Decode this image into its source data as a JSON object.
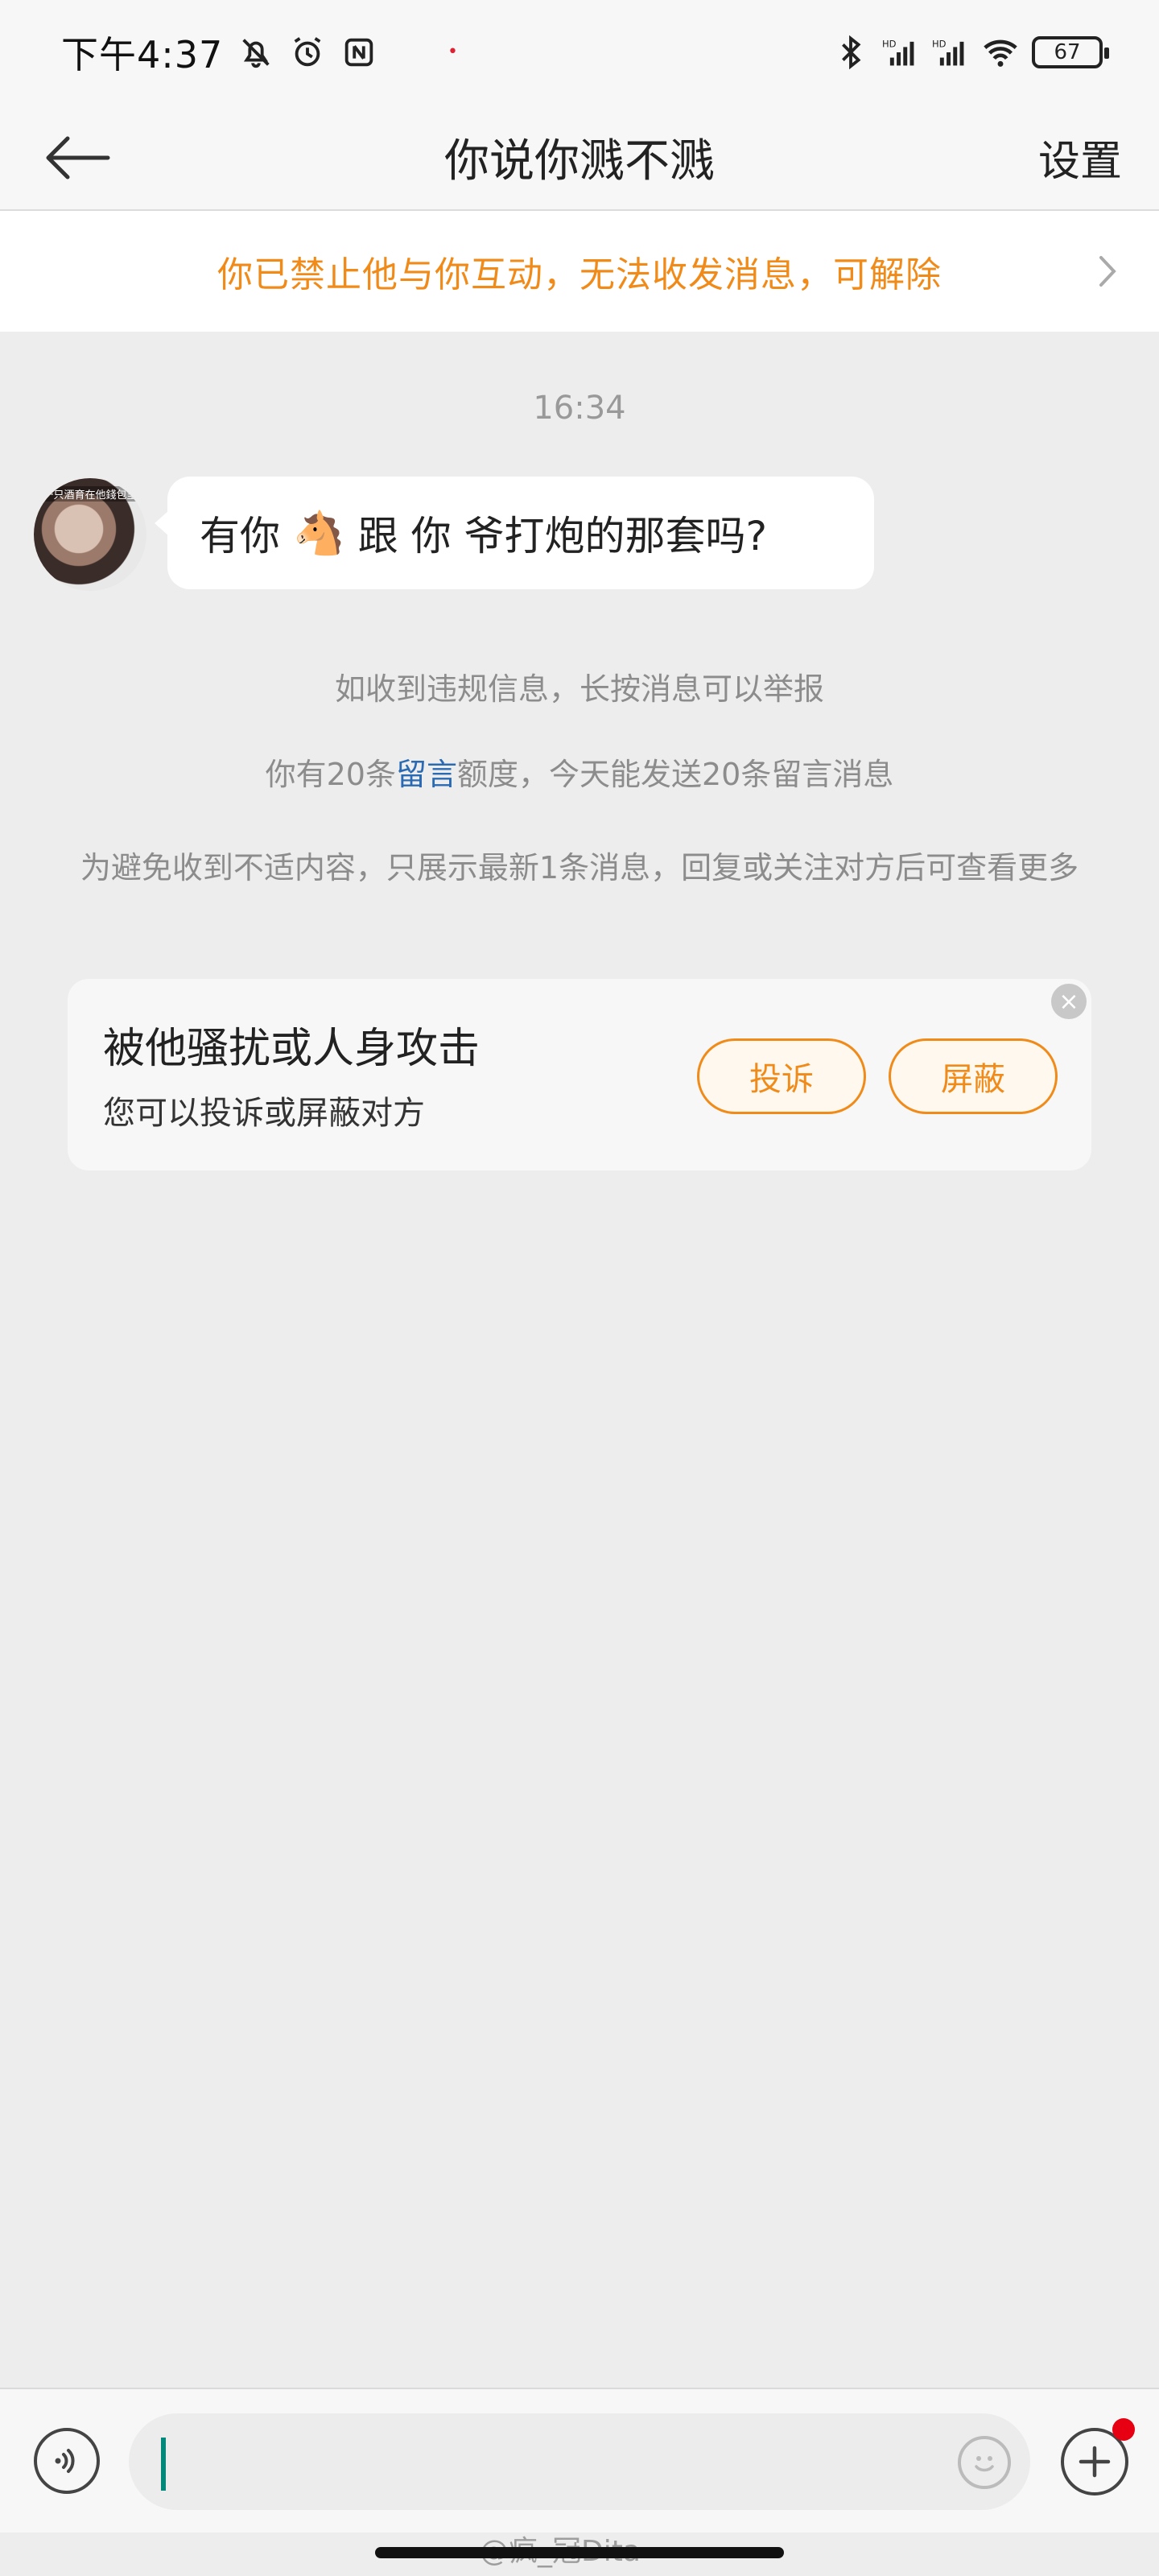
{
  "status_bar": {
    "time": "下午4:37",
    "battery": "67"
  },
  "nav": {
    "title": "你说你溅不溅",
    "settings_label": "设置"
  },
  "banner": {
    "text": "你已禁止他与你互动，无法收发消息，可解除"
  },
  "chat": {
    "timestamp": "16:34",
    "avatar_caption": "一只酒育在他錢包里",
    "message_pre": "有你",
    "message_emoji": "🐴",
    "message_post": "跟 你 爷打炮的那套吗?"
  },
  "system_notes": {
    "report": "如收到违规信息，长按消息可以举报",
    "quota_pre": "你有20条",
    "quota_link": "留言",
    "quota_post": "额度，今天能发送20条留言消息",
    "limit": "为避免收到不适内容，只展示最新1条消息，回复或关注对方后可查看更多"
  },
  "harass_card": {
    "title": "被他骚扰或人身攻击",
    "subtitle": "您可以投诉或屏蔽对方",
    "complain_label": "投诉",
    "block_label": "屏蔽"
  },
  "input_bar": {
    "placeholder": ""
  },
  "watermark": "@疯_冠Dita",
  "colors": {
    "accent_orange": "#f08b1a",
    "link_blue": "#2a6ab3",
    "background": "#ededed",
    "notification_red": "#e60012"
  }
}
